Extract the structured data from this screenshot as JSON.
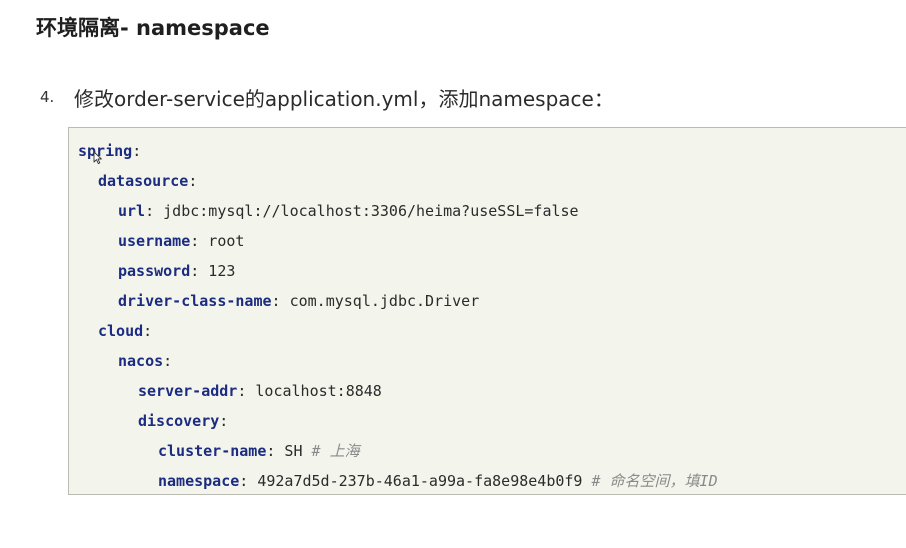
{
  "heading": {
    "title": "环境隔离- namespace"
  },
  "step": {
    "number": "4.",
    "text": "修改order-service的application.yml，添加namespace："
  },
  "code": {
    "lines": [
      {
        "key": "spring",
        "sep": ":",
        "value": "",
        "comment": ""
      },
      {
        "key": "datasource",
        "sep": ":",
        "value": "",
        "comment": ""
      },
      {
        "key": "url",
        "sep": ":",
        "value": " jdbc:mysql://localhost:3306/heima?useSSL=false",
        "comment": ""
      },
      {
        "key": "username",
        "sep": ":",
        "value": " root",
        "comment": ""
      },
      {
        "key": "password",
        "sep": ":",
        "value": " 123",
        "comment": ""
      },
      {
        "key": "driver-class-name",
        "sep": ":",
        "value": " com.mysql.jdbc.Driver",
        "comment": ""
      },
      {
        "key": "cloud",
        "sep": ":",
        "value": "",
        "comment": ""
      },
      {
        "key": "nacos",
        "sep": ":",
        "value": "",
        "comment": ""
      },
      {
        "key": "server-addr",
        "sep": ":",
        "value": " localhost:8848",
        "comment": ""
      },
      {
        "key": "discovery",
        "sep": ":",
        "value": "",
        "comment": ""
      },
      {
        "key": "cluster-name",
        "sep": ":",
        "value": " SH ",
        "comment": "# 上海"
      },
      {
        "key": "namespace",
        "sep": ":",
        "value": " 492a7d5d-237b-46a1-a99a-fa8e98e4b0f9 ",
        "comment": "# 命名空间，填ID"
      }
    ]
  },
  "colors": {
    "key": "#1c2c80",
    "comment": "#8a8a8a",
    "code_background": "#f3f5ec",
    "code_border": "#b9bcb3"
  },
  "icons": {
    "cursor": "mouse-pointer-icon"
  }
}
